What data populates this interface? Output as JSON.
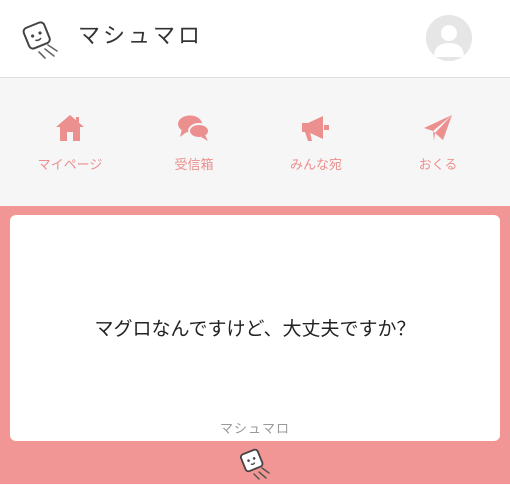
{
  "header": {
    "title": "マシュマロ",
    "logo_icon": "marshmallow-logo-icon",
    "avatar_icon": "user-avatar-icon"
  },
  "nav": {
    "items": [
      {
        "label": "マイページ",
        "icon": "home-icon"
      },
      {
        "label": "受信箱",
        "icon": "chat-bubbles-icon"
      },
      {
        "label": "みんな宛",
        "icon": "megaphone-icon"
      },
      {
        "label": "おくる",
        "icon": "paper-plane-icon"
      }
    ]
  },
  "card": {
    "message": "マグロなんですけど、大丈夫ですか？",
    "footer": "マシュマロ"
  },
  "colors": {
    "accent": "#ec8f8f",
    "content_bg": "#f29595",
    "nav_bg": "#f6f6f6",
    "title_text": "#333333",
    "footer_text": "#9a9a9a"
  }
}
